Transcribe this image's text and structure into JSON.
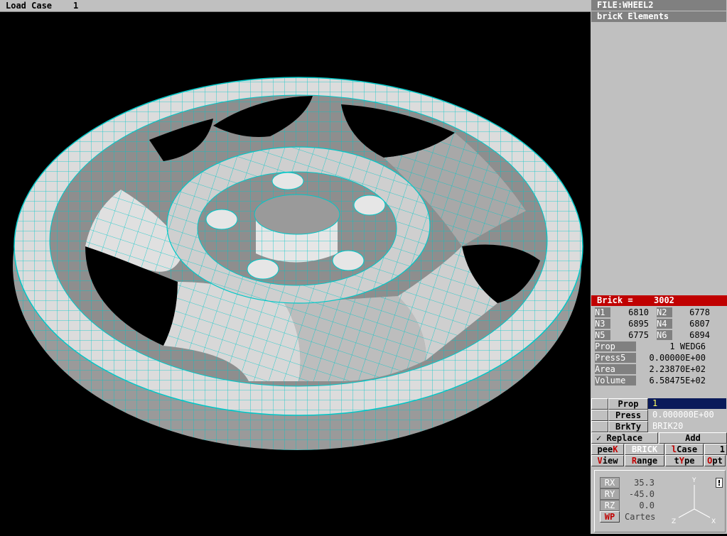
{
  "topbar": {
    "title": "Load Case",
    "value": "1"
  },
  "panel": {
    "file": "FILE:WHEEL2",
    "section": "bricK Elements",
    "brick": {
      "label": "Brick =",
      "id": "3002"
    },
    "nodes": [
      {
        "label": "N1",
        "value": "6810"
      },
      {
        "label": "N2",
        "value": "6778"
      },
      {
        "label": "N3",
        "value": "6895"
      },
      {
        "label": "N4",
        "value": "6807"
      },
      {
        "label": "N5",
        "value": "6775"
      },
      {
        "label": "N6",
        "value": "6894"
      }
    ],
    "props": [
      {
        "label": "Prop",
        "value": "1 WEDG6"
      },
      {
        "label": "Press5",
        "value": "0.00000E+00"
      },
      {
        "label": "Area",
        "value": "2.23870E+02"
      },
      {
        "label": "Volume",
        "value": "6.58475E+02"
      }
    ],
    "edit": [
      {
        "label": "Prop",
        "value": "1"
      },
      {
        "label": "Press",
        "value": "0.000000E+00"
      },
      {
        "label": "BrkTy",
        "value": "BRIK20"
      }
    ],
    "buttons": {
      "replace": "✓ Replace",
      "add": "Add",
      "peek": "peeK",
      "brick": "BRICK",
      "lcase": "lCase",
      "lcase_value": "1",
      "view": "View",
      "range": "Range",
      "type": "tYpe",
      "opt": "Opt"
    },
    "rotation": [
      {
        "label": "RX",
        "value": "35.3"
      },
      {
        "label": "RY",
        "value": "-45.0"
      },
      {
        "label": "RZ",
        "value": "0.0"
      }
    ],
    "wp": {
      "label": "WP",
      "value": "Cartes"
    },
    "axes": {
      "x": "X",
      "y": "Y",
      "z": "Z"
    }
  },
  "colors": {
    "mesh": "#00c0c0",
    "face_light": "#e6e6e6",
    "face_dark": "#8a8a8a",
    "panel": "#c0c0c0",
    "accent": "#c00000"
  }
}
